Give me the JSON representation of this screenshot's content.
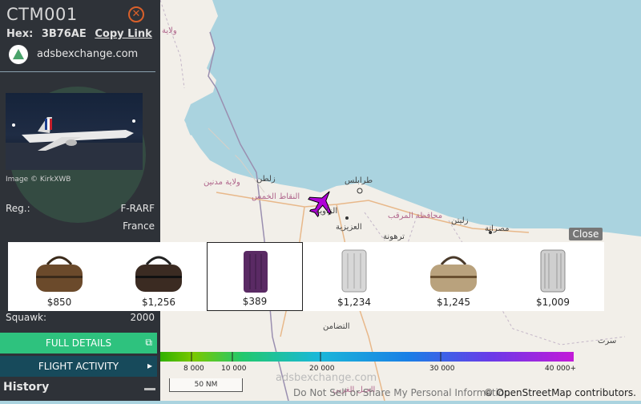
{
  "aircraft": {
    "callsign": "CTM001",
    "hex_label": "Hex:",
    "hex": "3B76AE",
    "copy_link": "Copy Link",
    "source": "adsbexchange.com",
    "image_credit": "Image © KirkXWB",
    "reg_label": "Reg.:",
    "reg": "F-RARF",
    "country": "France",
    "squawk_label": "Squawk:",
    "squawk": "2000"
  },
  "buttons": {
    "full_details": "FULL DETAILS",
    "flight_activity": "FLIGHT ACTIVITY",
    "history": "History"
  },
  "ads": {
    "close": "Close",
    "items": [
      {
        "price": "$850",
        "kind": "duffel-brown",
        "color": "#6b4a2b"
      },
      {
        "price": "$1,256",
        "kind": "duffel-dark",
        "color": "#3b2b22"
      },
      {
        "price": "$389",
        "kind": "suitcase-purple",
        "color": "#5a2a64"
      },
      {
        "price": "$1,234",
        "kind": "suitcase-silver",
        "color": "#c7c7c7"
      },
      {
        "price": "$1,245",
        "kind": "duffel-beige",
        "color": "#b9a27d"
      },
      {
        "price": "$1,009",
        "kind": "suitcase-aluminum",
        "color": "#bfbfbf"
      }
    ]
  },
  "altitude_legend": {
    "ticks": [
      "8 000",
      "10 000",
      "20 000",
      "30 000",
      "40 000+"
    ]
  },
  "map": {
    "scale": "50 NM",
    "watermark": "adsbexchange.com",
    "do_not_sell": "Do Not Sell or Share My Personal Information",
    "attribution": "© OpenStreetMap contributors.",
    "labels": {
      "l1": "ولاية",
      "l2": "زلطن",
      "l3": "ولاية مدنين",
      "l4": "النقاط الخمس",
      "l5": "طرابلس",
      "l6": "الزاوية",
      "l7": "العزيزية",
      "l8": "محافظة المرقب",
      "l9": "زليتن",
      "l10": "مصراتة",
      "l11": "ترهونة",
      "l12": "التضامن",
      "l13": "سرت",
      "l14": "الجبل الغربي",
      "l15": "ولاية"
    }
  },
  "colors": {
    "accent_green": "#2ec27e",
    "plane": "#b000d8",
    "sidebar_bg": "#2e3238"
  }
}
